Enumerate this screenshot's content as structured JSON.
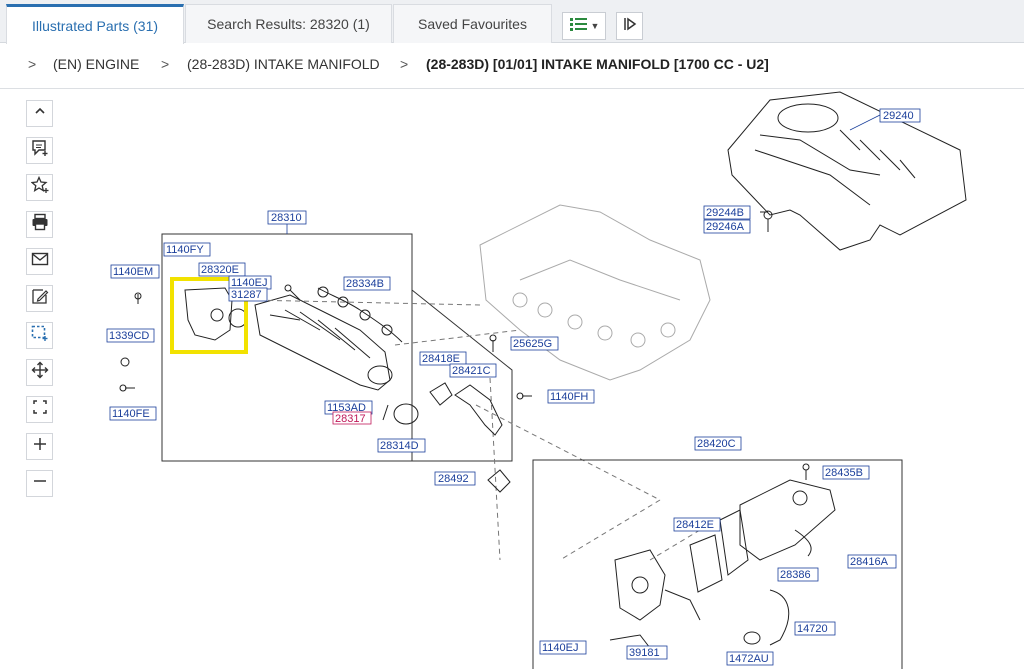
{
  "tabs": [
    {
      "label": "Illustrated Parts (31)",
      "active": true
    },
    {
      "label": "Search Results: 28320 (1)",
      "active": false
    },
    {
      "label": "Saved Favourites",
      "active": false
    }
  ],
  "breadcrumb": {
    "items": [
      "(EN) ENGINE",
      "(28-283D) INTAKE MANIFOLD",
      "(28-283D) [01/01] INTAKE MANIFOLD [1700 CC - U2]"
    ]
  },
  "left_toolbar": {
    "icons": [
      "chevron-up-icon",
      "add-note-icon",
      "favourite-add-icon",
      "print-icon",
      "mail-icon",
      "edit-sign-icon",
      "select-area-icon",
      "move-icon",
      "fit-screen-icon",
      "zoom-in-icon",
      "zoom-out-icon"
    ]
  },
  "diagram": {
    "labels": {
      "p29240": "29240",
      "p29244b": "29244B",
      "p29246a": "29246A",
      "p28310": "28310",
      "p1140fy": "1140FY",
      "p28320e": "28320E",
      "p1140ej": "1140EJ",
      "p31287": "31287",
      "p1140em": "1140EM",
      "p28334b": "28334B",
      "p1339cd": "1339CD",
      "p25625g": "25625G",
      "p28418e": "28418E",
      "p28421c": "28421C",
      "p1140fh": "1140FH",
      "p1140fe": "1140FE",
      "p1153ad": "1153AD",
      "p28317": "28317",
      "p28314d": "28314D",
      "p28492": "28492",
      "p28420c": "28420C",
      "p28435b": "28435B",
      "p28412e": "28412E",
      "p28416a": "28416A",
      "p28386": "28386",
      "p14720": "14720",
      "p1140ej2": "1140EJ",
      "p39181": "39181",
      "p1472au": "1472AU"
    },
    "highlight_color": "#f2e200",
    "label_color": "#1b3f9b"
  }
}
